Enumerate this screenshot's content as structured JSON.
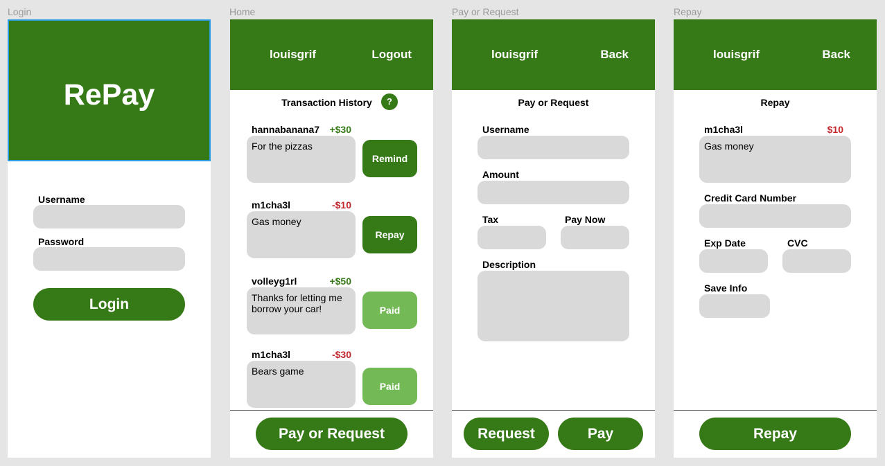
{
  "frames": {
    "login": {
      "frame_label": "Login",
      "logo": "RePay",
      "username_label": "Username",
      "username_value": "",
      "password_label": "Password",
      "password_value": "",
      "login_button": "Login"
    },
    "home": {
      "frame_label": "Home",
      "username": "louisgrif",
      "logout": "Logout",
      "title": "Transaction History",
      "help": "?",
      "transactions": [
        {
          "name": "hannabanana7",
          "amount": "+$30",
          "memo": "For the pizzas",
          "action": "Remind"
        },
        {
          "name": "m1cha3l",
          "amount": "-$10",
          "memo": "Gas money",
          "action": "Repay"
        },
        {
          "name": "volleyg1rl",
          "amount": "+$50",
          "memo": "Thanks for letting me borrow your car!",
          "action": "Paid"
        },
        {
          "name": "m1cha3l",
          "amount": "-$30",
          "memo": "Bears game",
          "action": "Paid"
        }
      ],
      "bottom_button": "Pay or Request"
    },
    "pay": {
      "frame_label": "Pay or Request",
      "username": "louisgrif",
      "back": "Back",
      "title": "Pay or Request",
      "username_label": "Username",
      "amount_label": "Amount",
      "tax_label": "Tax",
      "pay_now_label": "Pay Now",
      "description_label": "Description",
      "request_button": "Request",
      "pay_button": "Pay"
    },
    "repay": {
      "frame_label": "Repay",
      "username": "louisgrif",
      "back": "Back",
      "title": "Repay",
      "recipient": "m1cha3l",
      "amount": "$10",
      "memo": "Gas money",
      "card_label": "Credit Card Number",
      "exp_label": "Exp Date",
      "cvc_label": "CVC",
      "save_label": "Save Info",
      "repay_button": "Repay"
    }
  },
  "colors": {
    "brand_green": "#367a17",
    "paid_green": "#73b956",
    "negative_red": "#c1272d",
    "field_gray": "#d9d9d9",
    "canvas": "#e5e5e5",
    "selection_blue": "#2f9be0"
  }
}
